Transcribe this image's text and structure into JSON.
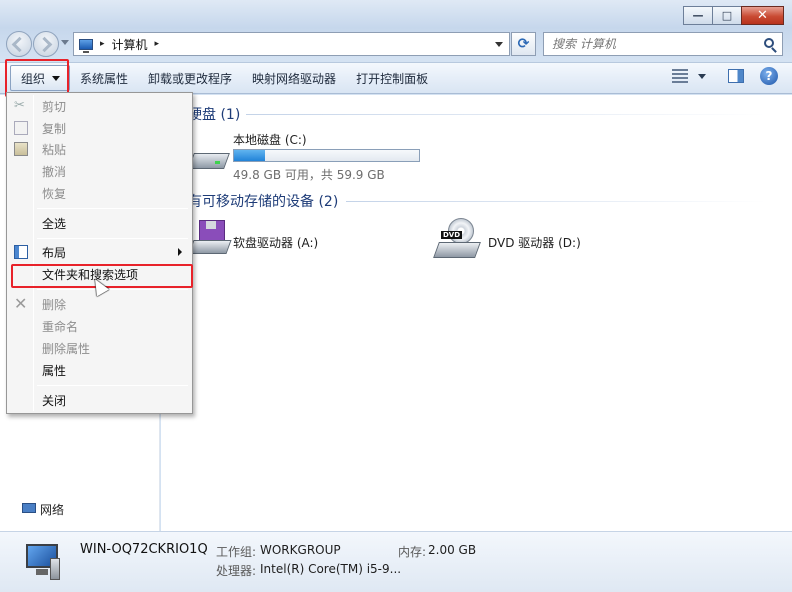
{
  "window": {
    "controls": {
      "minimize": "—",
      "maximize": "□",
      "close": "✕"
    }
  },
  "address": {
    "crumb_sep": "▸",
    "location": "计算机",
    "trail_sep": "▸",
    "refresh_glyph": "⟳",
    "search_placeholder": "搜索 计算机"
  },
  "toolbar": {
    "organize": "组织",
    "items": [
      "系统属性",
      "卸载或更改程序",
      "映射网络驱动器",
      "打开控制面板"
    ],
    "help": "?"
  },
  "groups": {
    "hdd": "硬盘 (1)",
    "removable": "有可移动存储的设备 (2)"
  },
  "drives": {
    "c": {
      "name": "本地磁盘 (C:)",
      "free_text": "49.8 GB 可用，共 59.9 GB",
      "used_fraction": 0.17
    },
    "floppy": {
      "name": "软盘驱动器 (A:)"
    },
    "dvd": {
      "name": "DVD 驱动器 (D:)",
      "badge": "DVD"
    }
  },
  "nav": {
    "network": "网络"
  },
  "menu": {
    "cut": "剪切",
    "copy": "复制",
    "paste": "粘贴",
    "undo": "撤消",
    "redo": "恢复",
    "select_all": "全选",
    "layout": "布局",
    "folder_options": "文件夹和搜索选项",
    "delete": "删除",
    "rename": "重命名",
    "remove_properties": "删除属性",
    "properties": "属性",
    "close": "关闭"
  },
  "details": {
    "name": "WIN-OQ72CKRIO1Q",
    "workgroup_label": "工作组:",
    "workgroup_value": "WORKGROUP",
    "memory_label": "内存:",
    "memory_value": "2.00 GB",
    "cpu_label": "处理器:",
    "cpu_value": "Intel(R) Core(TM) i5-9..."
  },
  "colors": {
    "highlight": "#e8222a",
    "accent": "#2183d8"
  }
}
